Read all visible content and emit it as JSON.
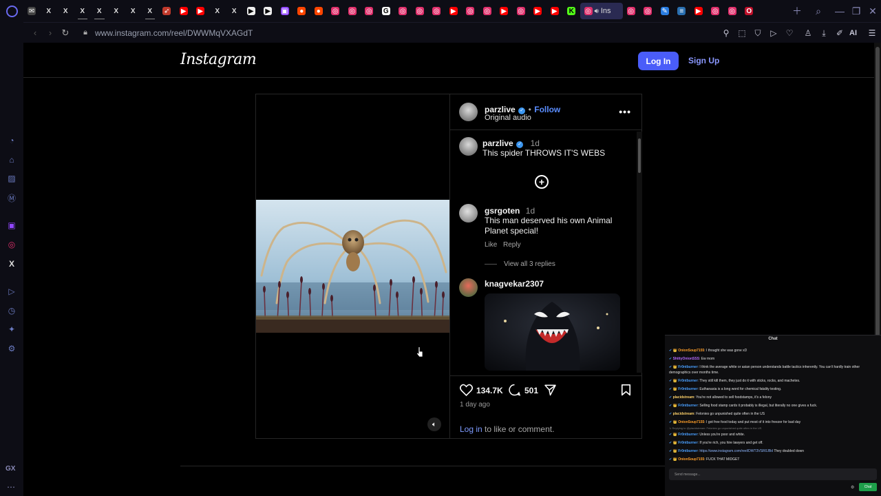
{
  "browser": {
    "url": "www.instagram.com/reel/DWWMqVXAGdT",
    "active_tab_label": "Ins",
    "ai_label": "AI",
    "sidebar_badge": "GX"
  },
  "tabs": [
    {
      "icon": "mail-icon",
      "color": "#444",
      "glyph": "✉"
    },
    {
      "icon": "x-icon",
      "color": "#000",
      "glyph": "X"
    },
    {
      "icon": "x-icon",
      "color": "#000",
      "glyph": "X"
    },
    {
      "icon": "x-icon",
      "color": "#000",
      "glyph": "X",
      "underline": true
    },
    {
      "icon": "x-icon",
      "color": "#000",
      "glyph": "X",
      "underline": true
    },
    {
      "icon": "x-icon",
      "color": "#000",
      "glyph": "X"
    },
    {
      "icon": "x-icon",
      "color": "#000",
      "glyph": "X"
    },
    {
      "icon": "x-icon",
      "color": "#000",
      "glyph": "X",
      "underline": true
    },
    {
      "icon": "feather-icon",
      "color": "#c0392b",
      "glyph": "➶"
    },
    {
      "icon": "youtube-icon",
      "color": "#ff0000",
      "glyph": "▶"
    },
    {
      "icon": "youtube-icon",
      "color": "#ff0000",
      "glyph": "▶"
    },
    {
      "icon": "x-icon",
      "color": "#000",
      "glyph": "X"
    },
    {
      "icon": "x-icon",
      "color": "#000",
      "glyph": "X"
    },
    {
      "icon": "play-doc-icon",
      "color": "#eee",
      "glyph": "▶",
      "dark": true
    },
    {
      "icon": "play-doc-icon",
      "color": "#eee",
      "glyph": "▶",
      "dark": true
    },
    {
      "icon": "twitch-icon",
      "color": "#9146ff",
      "glyph": "▣"
    },
    {
      "icon": "reddit-icon",
      "color": "#ff4500",
      "glyph": "●"
    },
    {
      "icon": "reddit-icon",
      "color": "#ff4500",
      "glyph": "●"
    },
    {
      "icon": "instagram-icon",
      "color": "#e1306c",
      "glyph": "◎"
    },
    {
      "icon": "instagram-icon",
      "color": "#e1306c",
      "glyph": "◎"
    },
    {
      "icon": "instagram-icon",
      "color": "#e1306c",
      "glyph": "◎"
    },
    {
      "icon": "google-icon",
      "color": "#fff",
      "glyph": "G",
      "dark": true
    },
    {
      "icon": "instagram-icon",
      "color": "#e1306c",
      "glyph": "◎"
    },
    {
      "icon": "instagram-icon",
      "color": "#e1306c",
      "glyph": "◎"
    },
    {
      "icon": "instagram-icon",
      "color": "#e1306c",
      "glyph": "◎"
    },
    {
      "icon": "youtube-icon",
      "color": "#ff0000",
      "glyph": "▶"
    },
    {
      "icon": "instagram-icon",
      "color": "#e1306c",
      "glyph": "◎"
    },
    {
      "icon": "instagram-icon",
      "color": "#e1306c",
      "glyph": "◎"
    },
    {
      "icon": "youtube-icon",
      "color": "#ff0000",
      "glyph": "▶"
    },
    {
      "icon": "instagram-icon",
      "color": "#e1306c",
      "glyph": "◎"
    },
    {
      "icon": "youtube-icon",
      "color": "#ff0000",
      "glyph": "▶"
    },
    {
      "icon": "youtube-icon",
      "color": "#ff0000",
      "glyph": "▶"
    },
    {
      "icon": "kick-icon",
      "color": "#53fc18",
      "glyph": "K",
      "dark": true
    }
  ],
  "tabs_after": [
    {
      "icon": "instagram-icon",
      "color": "#e1306c",
      "glyph": "◎"
    },
    {
      "icon": "instagram-icon",
      "color": "#e1306c",
      "glyph": "◎"
    },
    {
      "icon": "draw-icon",
      "color": "#2a7de1",
      "glyph": "✎"
    },
    {
      "icon": "board-icon",
      "color": "#2a6fb0",
      "glyph": "≡"
    },
    {
      "icon": "youtube-icon",
      "color": "#ff0000",
      "glyph": "▶"
    },
    {
      "icon": "instagram-icon",
      "color": "#e1306c",
      "glyph": "◎"
    },
    {
      "icon": "instagram-icon",
      "color": "#e1306c",
      "glyph": "◎"
    },
    {
      "icon": "opera-icon",
      "color": "#c0102a",
      "glyph": "O"
    }
  ],
  "header": {
    "logo": "Instagram",
    "login": "Log In",
    "signup": "Sign Up"
  },
  "post": {
    "author": "parzlive",
    "follow": "Follow",
    "dot": "•",
    "audio": "Original audio",
    "caption_time": "1d",
    "caption": "This spider THROWS IT'S WEBS",
    "comments": [
      {
        "user": "gsrgoten",
        "time": "1d",
        "text": "This man deserved his own Animal Planet special!",
        "like": "Like",
        "reply": "Reply",
        "view_replies": "View all 3 replies"
      },
      {
        "user": "knagvekar2307"
      }
    ],
    "likes": "134.7K",
    "comment_count": "501",
    "time_ago": "1 day ago",
    "login_link": "Log in",
    "login_rest": " to like or comment."
  },
  "chat": {
    "title": "Chat",
    "input_placeholder": "Send message...",
    "send": "Chat",
    "messages": [
      {
        "badge": "✔ 👑",
        "name": "OnionSoup7155",
        "color": "#ff9f2a",
        "text": ": I thought she was gone xD"
      },
      {
        "badge": "✔",
        "name": "ShittyOnionSSS",
        "color": "#b86bff",
        "text": ": Ew mom"
      },
      {
        "badge": "✔ 👑",
        "name": "Fr0ntburner",
        "color": "#4aa0ff",
        "text": ": I think the average white or asian person understands battle tactics inherently. You can't hardly train other demographics over months time.",
        "wrap": true
      },
      {
        "badge": "✔ 👑",
        "name": "Fr0ntburner",
        "color": "#4aa0ff",
        "text": ": They still kill them, they just do it with sticks, rocks, and machetes."
      },
      {
        "badge": "✔ 👑",
        "name": "Fr0ntburner",
        "color": "#4aa0ff",
        "text": ": Euthanasia is a long word for chemical fatality testing."
      },
      {
        "badge": "✔",
        "name": "placidstream",
        "color": "#ffd36b",
        "text": ": You're not allowed to sell foodstamps, it's a felony"
      },
      {
        "badge": "✔ 👑",
        "name": "Fr0ntburner",
        "color": "#4aa0ff",
        "text": ": Selling food stamp cards it probably is illegal, but literally no one gives a fuck."
      },
      {
        "badge": "✔",
        "name": "placidstream",
        "color": "#ffd36b",
        "text": ": Felonies go unpunished quite often in the US"
      },
      {
        "badge": "✔ 👑",
        "name": "OnionSoup7155",
        "color": "#ff9f2a",
        "text": ": I got free food today and put most of it into freezer for bad day"
      },
      {
        "note": "↳ Replying to @placidstream: Felonies go unpunished quite often in the US"
      },
      {
        "badge": "✔ 👑",
        "name": "Fr0ntburner",
        "color": "#4aa0ff",
        "text": ": Unless you're poor and white."
      },
      {
        "badge": "✔ 👑",
        "name": "Fr0ntburner",
        "color": "#4aa0ff",
        "text": ": If you're rich, you hire lawyers and get off."
      },
      {
        "badge": "✔ 👑",
        "name": "Fr0ntburner",
        "color": "#4aa0ff",
        "link": "https://www.instagram.com/reel/DWT3VSR0JBd",
        "text": " They doubled down"
      },
      {
        "badge": "✔ 👑",
        "name": "OnionSoup7155",
        "color": "#ff9f2a",
        "text": ": FUCK THAT MIDGET"
      }
    ]
  },
  "colors": {
    "accent": "#4a5df9",
    "link": "#5a8dff",
    "verified": "#3b96f0"
  }
}
